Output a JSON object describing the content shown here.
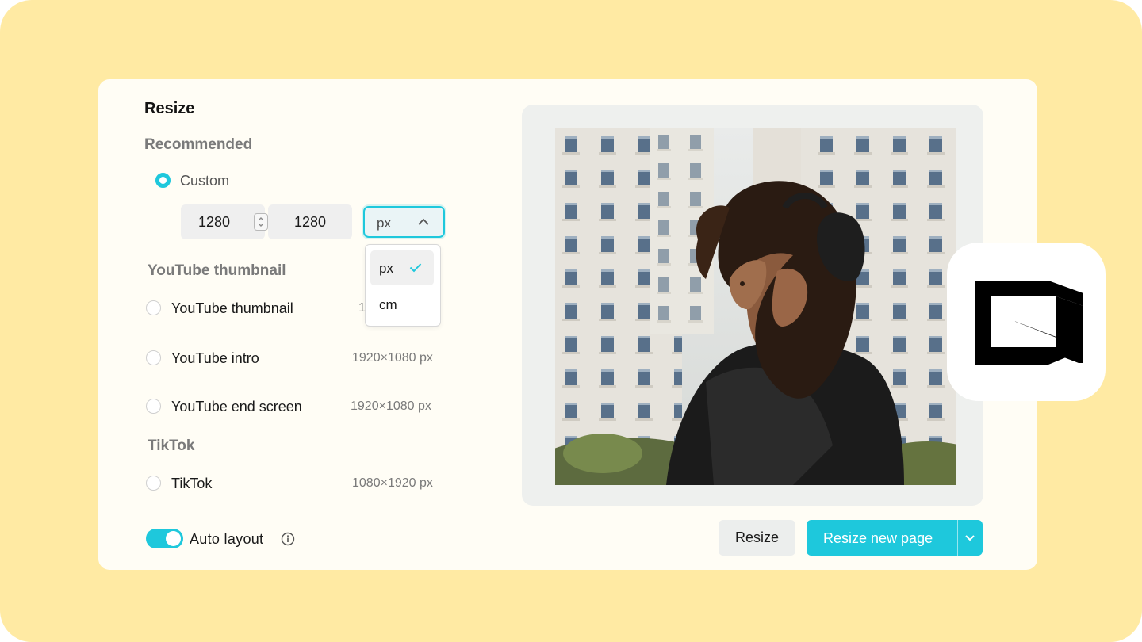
{
  "panel": {
    "title": "Resize",
    "recommended_label": "Recommended",
    "custom": {
      "label": "Custom",
      "selected": true,
      "width_value": "1280",
      "height_value": "1280",
      "unit_value": "px"
    },
    "unit_dropdown": {
      "options": [
        "px",
        "cm"
      ],
      "selected": "px"
    },
    "groups": [
      {
        "heading": "YouTube thumbnail",
        "options": [
          {
            "label": "YouTube thumbnail",
            "size": "1"
          },
          {
            "label": "YouTube intro",
            "size": "1920×1080 px"
          },
          {
            "label": "YouTube end screen",
            "size": "1920×1080 px"
          }
        ]
      },
      {
        "heading": "TikTok",
        "options": [
          {
            "label": "TikTok",
            "size": "1080×1920 px"
          }
        ]
      }
    ],
    "auto_layout": {
      "label": "Auto layout",
      "enabled": true
    }
  },
  "actions": {
    "resize_label": "Resize",
    "resize_new_page_label": "Resize new page"
  },
  "colors": {
    "accent": "#1ec8dc",
    "backdrop": "#ffeaa3",
    "card": "#fffdf5"
  },
  "icons": {
    "selected_check": "check-icon",
    "dropdown_open": "chevron-up-icon",
    "split_button": "chevron-down-icon",
    "info": "info-icon",
    "brand": "capcut-logo-icon"
  }
}
